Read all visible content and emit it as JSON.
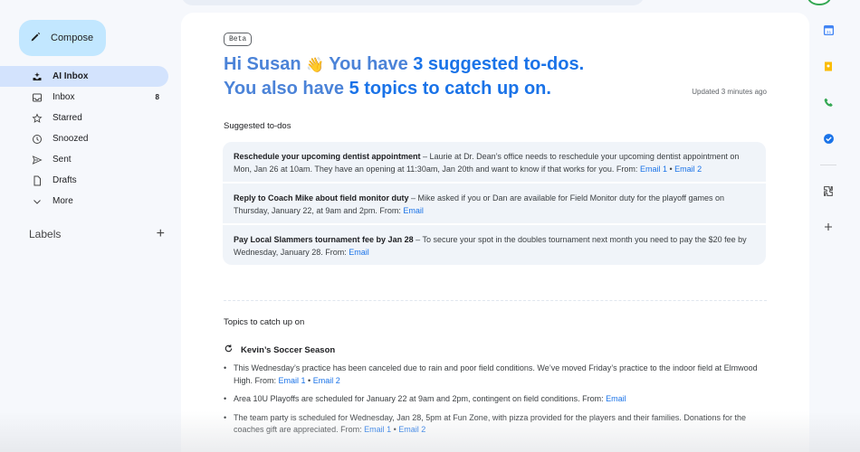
{
  "sidebar": {
    "compose_label": "Compose",
    "items": [
      {
        "label": "AI Inbox",
        "count": ""
      },
      {
        "label": "Inbox",
        "count": "8"
      },
      {
        "label": "Starred",
        "count": ""
      },
      {
        "label": "Snoozed",
        "count": ""
      },
      {
        "label": "Sent",
        "count": ""
      },
      {
        "label": "Drafts",
        "count": ""
      },
      {
        "label": "More",
        "count": ""
      }
    ],
    "labels_title": "Labels",
    "labels_add": "+"
  },
  "main": {
    "beta_badge": "Beta",
    "greeting": {
      "line1_prefix": "Hi Susan ",
      "wave": "👋",
      "line1_mid": " You have ",
      "line1_highlight": "3 suggested to-dos.",
      "line2_prefix": "You also have ",
      "line2_highlight": "5 topics to catch up on."
    },
    "updated": "Updated 3 minutes ago",
    "todos_title": "Suggested to-dos",
    "todos": [
      {
        "title": "Reschedule your upcoming dentist appointment",
        "body": " – Laurie at Dr. Dean’s office needs to reschedule your upcoming dentist appointment on Mon, Jan 26 at 10am. They have an opening at 11:30am, Jan 20th and want to know if that works for you.  From: ",
        "link1": "Email 1",
        "sep": " • ",
        "link2": "Email 2"
      },
      {
        "title": "Reply to Coach Mike about field monitor duty",
        "body": " – Mike asked if you or Dan are available for Field Monitor duty for the playoff games on Thursday, January 22, at 9am and 2pm.  From: ",
        "link1": "Email",
        "sep": "",
        "link2": ""
      },
      {
        "title": "Pay Local Slammers tournament fee by Jan 28",
        "body": " – To secure your spot in the doubles tournament next month you need to pay the $20 fee by Wednesday, January 28.  From: ",
        "link1": "Email",
        "sep": "",
        "link2": ""
      }
    ],
    "topics_title": "Topics to catch up on",
    "topic": {
      "title": "Kevin’s Soccer Season",
      "bullets": [
        {
          "text": "This Wednesday’s practice has been canceled due to rain and poor field conditions. We’ve moved Friday’s practice to the indoor field at Elmwood High.  From: ",
          "link1": "Email 1",
          "sep": " • ",
          "link2": "Email 2"
        },
        {
          "text": "Area 10U Playoffs are scheduled for January 22 at 9am and 2pm, contingent on field conditions.  From: ",
          "link1": "Email",
          "sep": "",
          "link2": ""
        },
        {
          "text": "The team party is scheduled for Wednesday, Jan 28, 5pm at Fun Zone, with pizza provided for the players and their families. Donations for the coaches gift are appreciated.  From: ",
          "link1": "Email 1",
          "sep": " • ",
          "link2": "Email 2"
        }
      ]
    }
  },
  "rail": {
    "icons": [
      "calendar-icon",
      "keep-icon",
      "phone-icon",
      "tasks-icon",
      "addons-icon",
      "add-icon"
    ]
  },
  "colors": {
    "accent": "#1a73e8",
    "compose_bg": "#c2e7ff",
    "active_nav": "#d3e3fd",
    "greeting": "#4b83d8"
  }
}
